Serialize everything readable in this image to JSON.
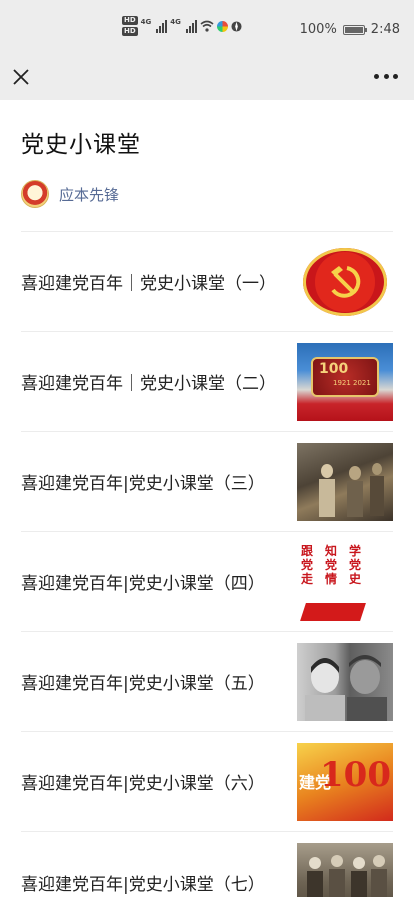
{
  "status_bar": {
    "hd1": "HD",
    "hd2": "HD",
    "net1": "4G",
    "net2": "4G",
    "battery": "100%",
    "time": "2:48",
    "icons": [
      "signal-icon",
      "wifi-icon",
      "app-bubble-icon",
      "settings-icon",
      "battery-icon"
    ]
  },
  "nav": {
    "close_icon": "close-icon",
    "more_icon": "more-icon"
  },
  "article": {
    "title": "党史小课堂",
    "author": "应本先锋"
  },
  "items": [
    {
      "title": "喜迎建党百年｜党史小课堂（一）"
    },
    {
      "title": "喜迎建党百年｜党史小课堂（二）",
      "thumb_text": [
        "100",
        "1921",
        "2021"
      ]
    },
    {
      "title": "喜迎建党百年|党史小课堂（三）"
    },
    {
      "title": "喜迎建党百年|党史小课堂（四）",
      "thumb_text": [
        "跟",
        "党",
        "走",
        "知",
        "党",
        "情",
        "学",
        "党",
        "史"
      ]
    },
    {
      "title": "喜迎建党百年|党史小课堂（五）"
    },
    {
      "title": "喜迎建党百年|党史小课堂（六）",
      "thumb_text": [
        "建党",
        "100"
      ]
    },
    {
      "title": "喜迎建党百年|党史小课堂（七）"
    }
  ]
}
